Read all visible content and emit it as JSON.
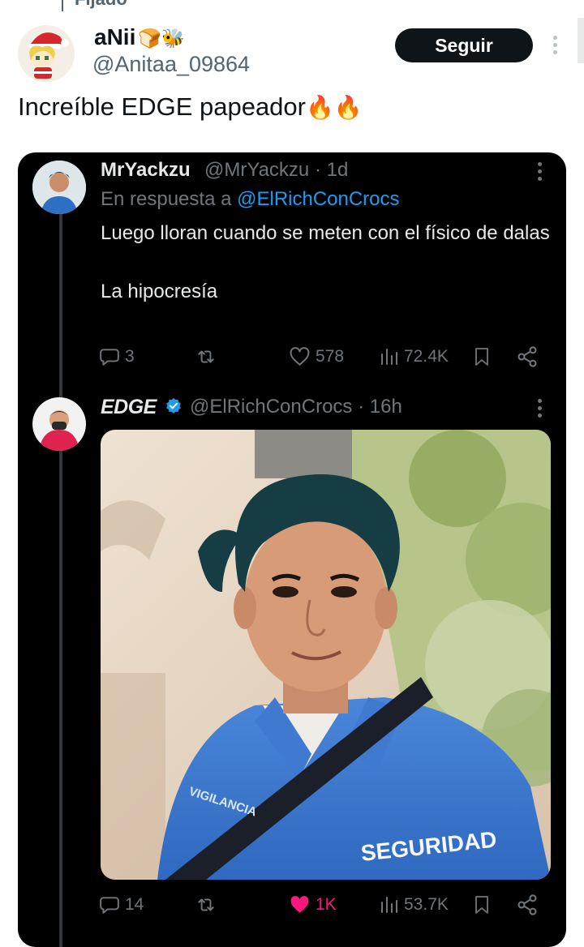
{
  "pinned_label": "Fijado",
  "tweet": {
    "author_name": "aNii",
    "author_emoji": "🍞🐝",
    "author_handle": "@Anitaa_09864",
    "follow_label": "Seguir",
    "text": "Increíble EDGE papeador",
    "text_emoji": "🔥🔥"
  },
  "quoted_reply": {
    "name": "MrYackzu",
    "handle": "@MrYackzu",
    "separator": "·",
    "time": "1d",
    "reply_prefix": "En respuesta a",
    "reply_to": "@ElRichConCrocs",
    "body_line1": "Luego lloran cuando se meten con el físico de dalas",
    "body_line2": "La hipocresía",
    "stats": {
      "replies": "3",
      "likes": "578",
      "views": "72.4K"
    }
  },
  "quoted_post": {
    "name": "EDGE",
    "handle": "@ElRichConCrocs",
    "separator": "·",
    "time": "16h",
    "photo_text_badge": "SEGURIDAD",
    "photo_text_shoulder": "VIGILANCIA",
    "stats": {
      "replies": "14",
      "likes": "1K",
      "views": "53.7K"
    }
  },
  "colors": {
    "link": "#1d9bf0",
    "like_active": "#f91880",
    "verified": "#1d9bf0",
    "card_bg": "#000000"
  }
}
